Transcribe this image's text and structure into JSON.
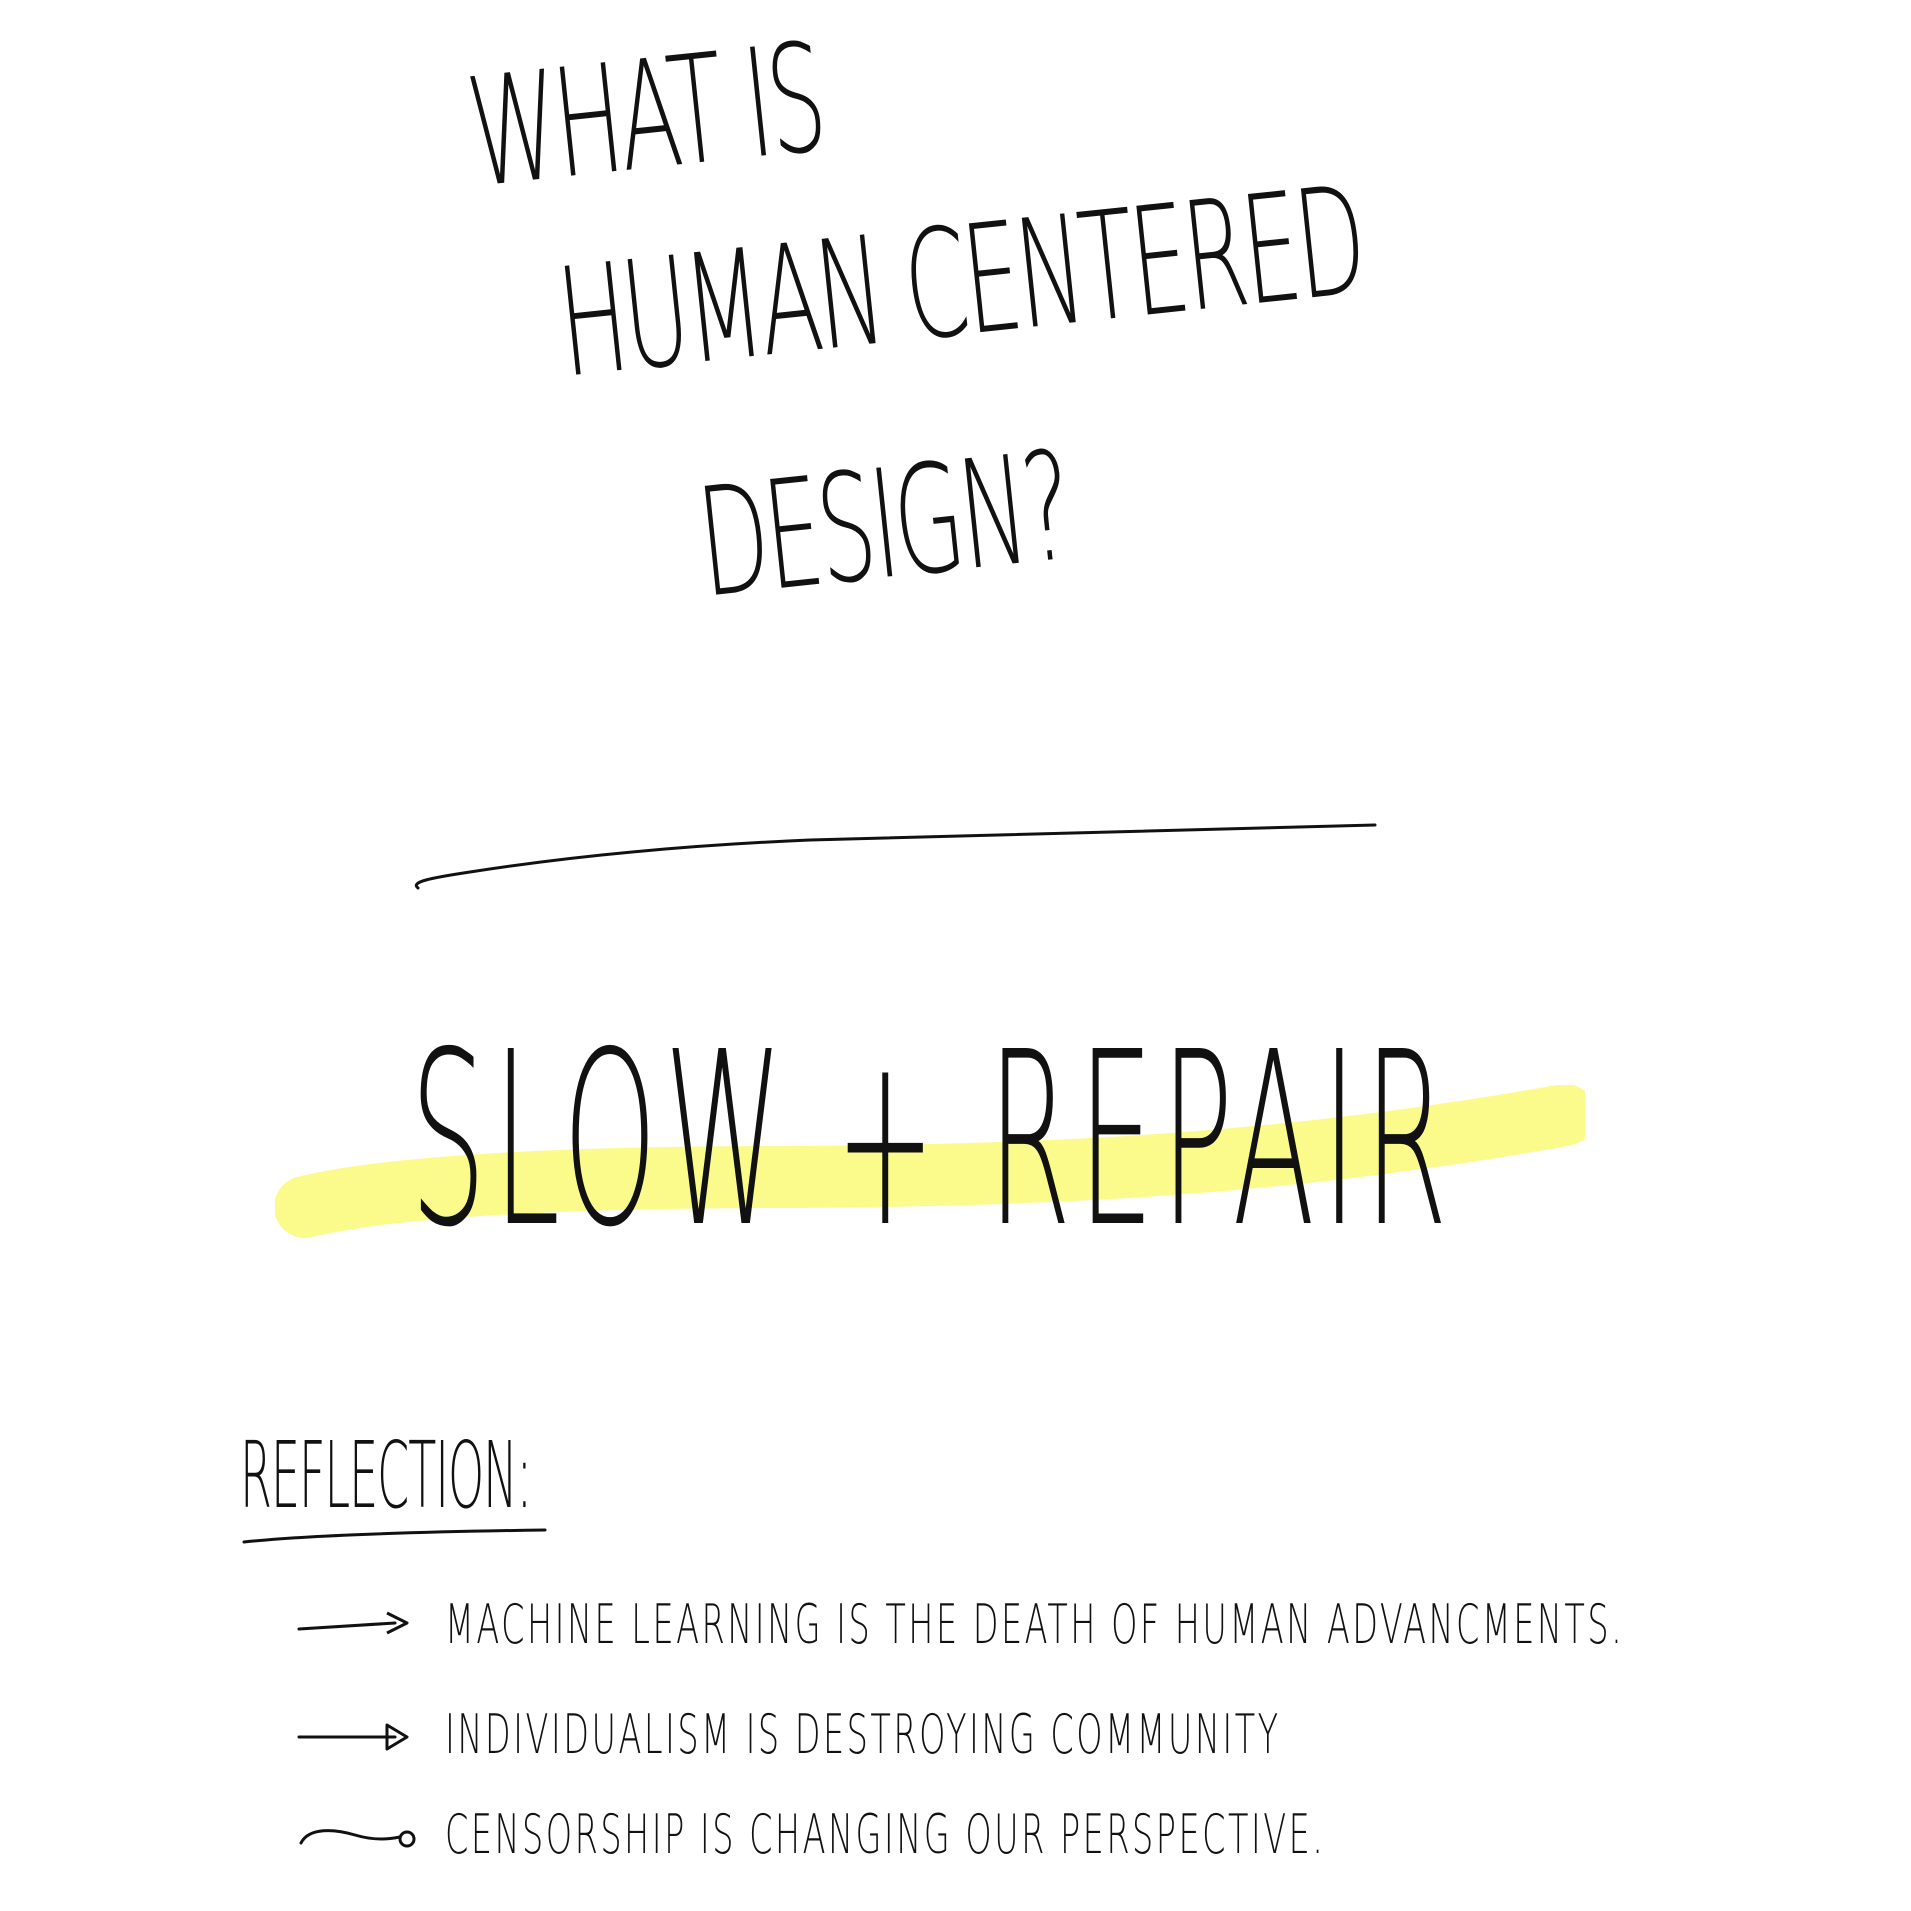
{
  "title": {
    "line1": "WHAT IS",
    "line2": "HUMAN CENTERED",
    "line3": "DESIGN?"
  },
  "highlight_phrase": "SLOW + REPAIR",
  "highlight_color": "#fbfb8c",
  "reflection": {
    "heading": "REFLECTION:",
    "points": [
      "MACHINE LEARNING IS THE DEATH OF HUMAN ADVANCMENTS.",
      "INDIVIDUALISM IS DESTROYING COMMUNITY",
      "CENSORSHIP IS CHANGING OUR PERSPECTIVE."
    ]
  }
}
